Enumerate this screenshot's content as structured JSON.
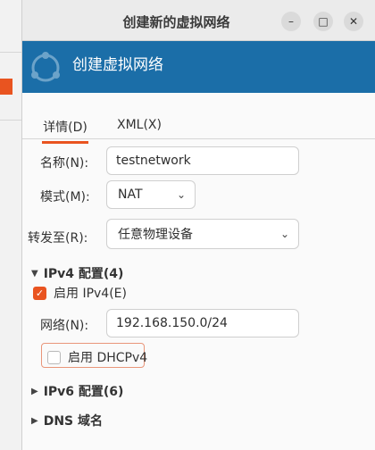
{
  "window": {
    "title": "创建新的虚拟网络",
    "controls": {
      "minimize": "–",
      "maximize": "□",
      "close": "✕"
    }
  },
  "banner": {
    "title": "创建虚拟网络"
  },
  "tabs": [
    {
      "label": "详情(D)",
      "active": true
    },
    {
      "label": "XML(X)",
      "active": false
    }
  ],
  "form": {
    "name_label": "名称(N):",
    "name_value": "testnetwork",
    "mode_label": "模式(M):",
    "mode_value": "NAT",
    "forward_label": "转发至(R):",
    "forward_value": "任意物理设备"
  },
  "ipv4": {
    "section_label": "IPv4 配置(4)",
    "enable_label": "启用 IPv4(E)",
    "enabled": true,
    "network_label": "网络(N):",
    "network_value": "192.168.150.0/24",
    "dhcp_label": "启用 DHCPv4",
    "dhcp_enabled": false
  },
  "ipv6": {
    "section_label": "IPv6 配置(6)"
  },
  "dns": {
    "section_label": "DNS 域名"
  },
  "colors": {
    "accent": "#e95420",
    "banner": "#1b6ea8"
  },
  "icons": {
    "expanded": "chevron-down-icon",
    "collapsed": "chevron-right-icon"
  }
}
